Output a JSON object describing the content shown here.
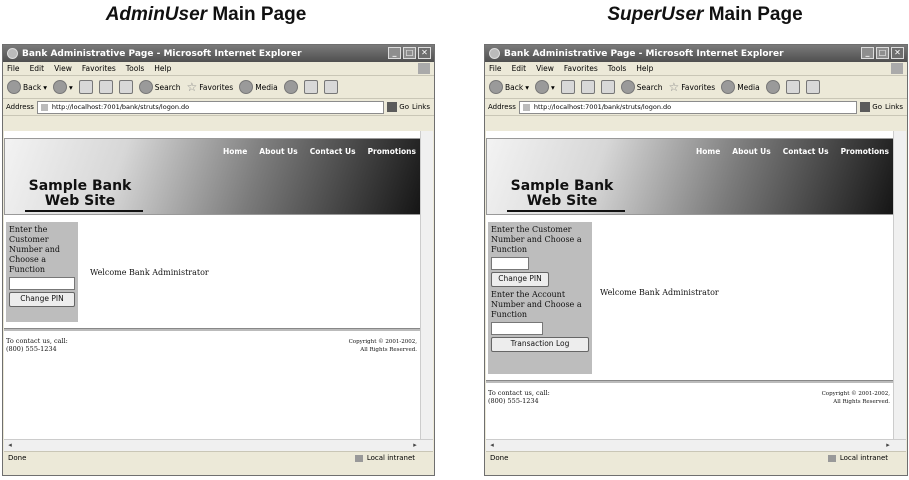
{
  "captions": {
    "left": {
      "role": "AdminUser",
      "rest": " Main Page"
    },
    "right": {
      "role": "SuperUser",
      "rest": " Main Page"
    }
  },
  "browser": {
    "title": "Bank Administrative Page - Microsoft Internet Explorer",
    "menu": [
      "File",
      "Edit",
      "View",
      "Favorites",
      "Tools",
      "Help"
    ],
    "toolbar": {
      "back": "Back",
      "search": "Search",
      "favorites": "Favorites",
      "media": "Media"
    },
    "address_label": "Address",
    "url": "http://localhost:7001/bank/struts/logon.do",
    "go": "Go",
    "links": "Links",
    "status": "Done",
    "zone": "Local intranet"
  },
  "site": {
    "nav": [
      "Home",
      "About Us",
      "Contact Us",
      "Promotions"
    ],
    "name_line1": "Sample Bank",
    "name_line2": "Web Site",
    "welcome": "Welcome Bank Administrator",
    "contact_line1": "To contact us, call:",
    "contact_line2": "(800) 555-1234",
    "copyright_line1": "Copyright © 2001-2002,",
    "copyright_line2": "All Rights Reserved."
  },
  "admin_panel": {
    "prompt": "Enter the Customer Number and Choose a Function",
    "button": "Change PIN"
  },
  "super_panel": {
    "customer_prompt": "Enter the Customer Number and Choose a Function",
    "customer_button": "Change PIN",
    "account_prompt": "Enter the Account Number and Choose a Function",
    "account_button": "Transaction Log"
  }
}
